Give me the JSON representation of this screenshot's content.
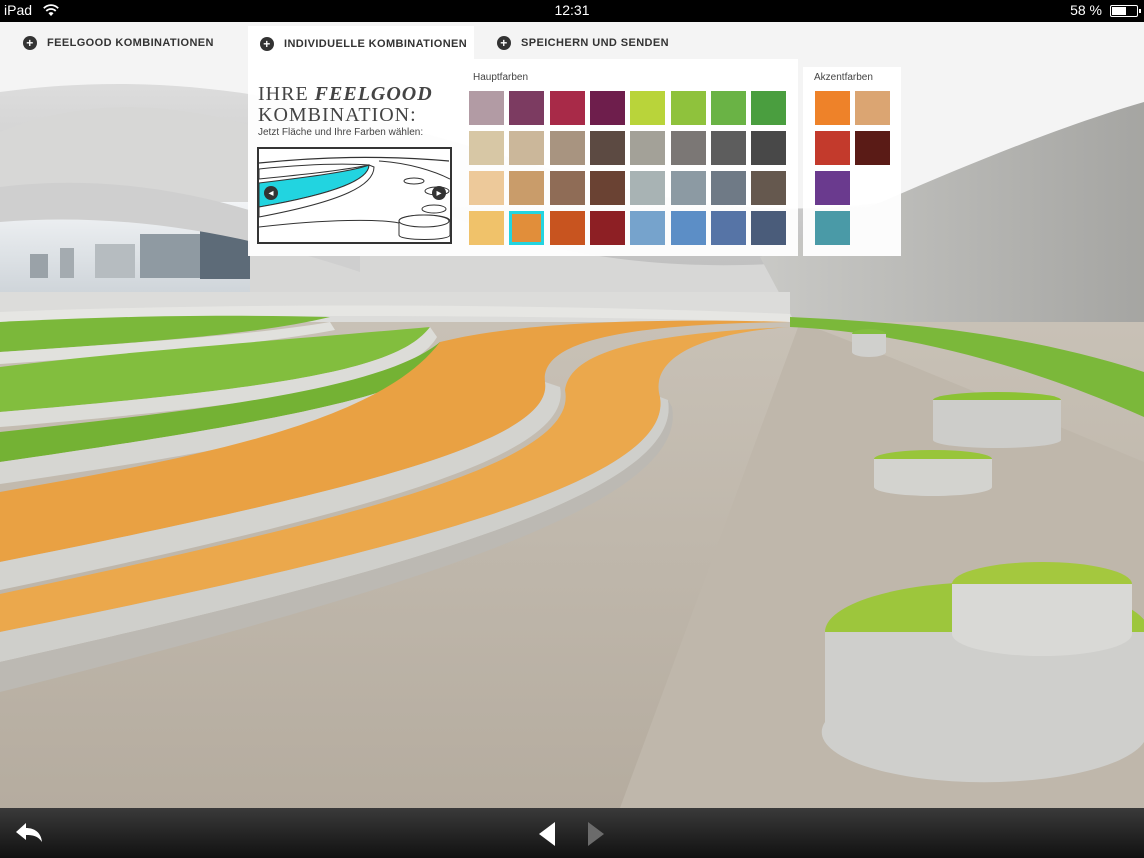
{
  "status_bar": {
    "device": "iPad",
    "time": "12:31",
    "battery": "58 %"
  },
  "tabs": [
    {
      "label": "FEELGOOD KOMBINATIONEN"
    },
    {
      "label": "INDIVIDUELLE KOMBINATIONEN"
    },
    {
      "label": "SPEICHERN UND SENDEN"
    }
  ],
  "tab_plus": "+",
  "panel": {
    "title_line1_a": "IHRE ",
    "title_line1_b": "FEELGOOD",
    "title_line2": "KOMBINATION:",
    "subtitle": "Jetzt Fläche und Ihre Farben wählen:",
    "main_colors_label": "Hauptfarben",
    "accent_colors_label": "Akzentfarben"
  },
  "main_colors": [
    [
      "#b29ba4",
      "#7c3b61",
      "#a82a48",
      "#6e1e4c",
      "#b9d43a",
      "#8fc23c",
      "#6ab345",
      "#4a9e3f"
    ],
    [
      "#d7c7a5",
      "#cbb79a",
      "#a89480",
      "#5c4a42",
      "#a3a198",
      "#7b7775",
      "#5d5d5d",
      "#484848"
    ],
    [
      "#edc99a",
      "#c99c6a",
      "#8f6c56",
      "#6a4233",
      "#a8b3b4",
      "#8c9aa3",
      "#6f7a86",
      "#65584e"
    ],
    [
      "#f0c26a",
      "#e18e3a",
      "#c8541f",
      "#8d1f24",
      "#76a3cc",
      "#5c8ec6",
      "#5674a6",
      "#4a5c7a"
    ]
  ],
  "selected_main": {
    "row": 3,
    "col": 1
  },
  "accent_colors": [
    [
      "#ee8229",
      "#dba572"
    ],
    [
      "#c33a2c",
      "#5a1b16"
    ],
    [
      "#6a3a8e"
    ],
    [
      "#4a9aa7"
    ]
  ]
}
